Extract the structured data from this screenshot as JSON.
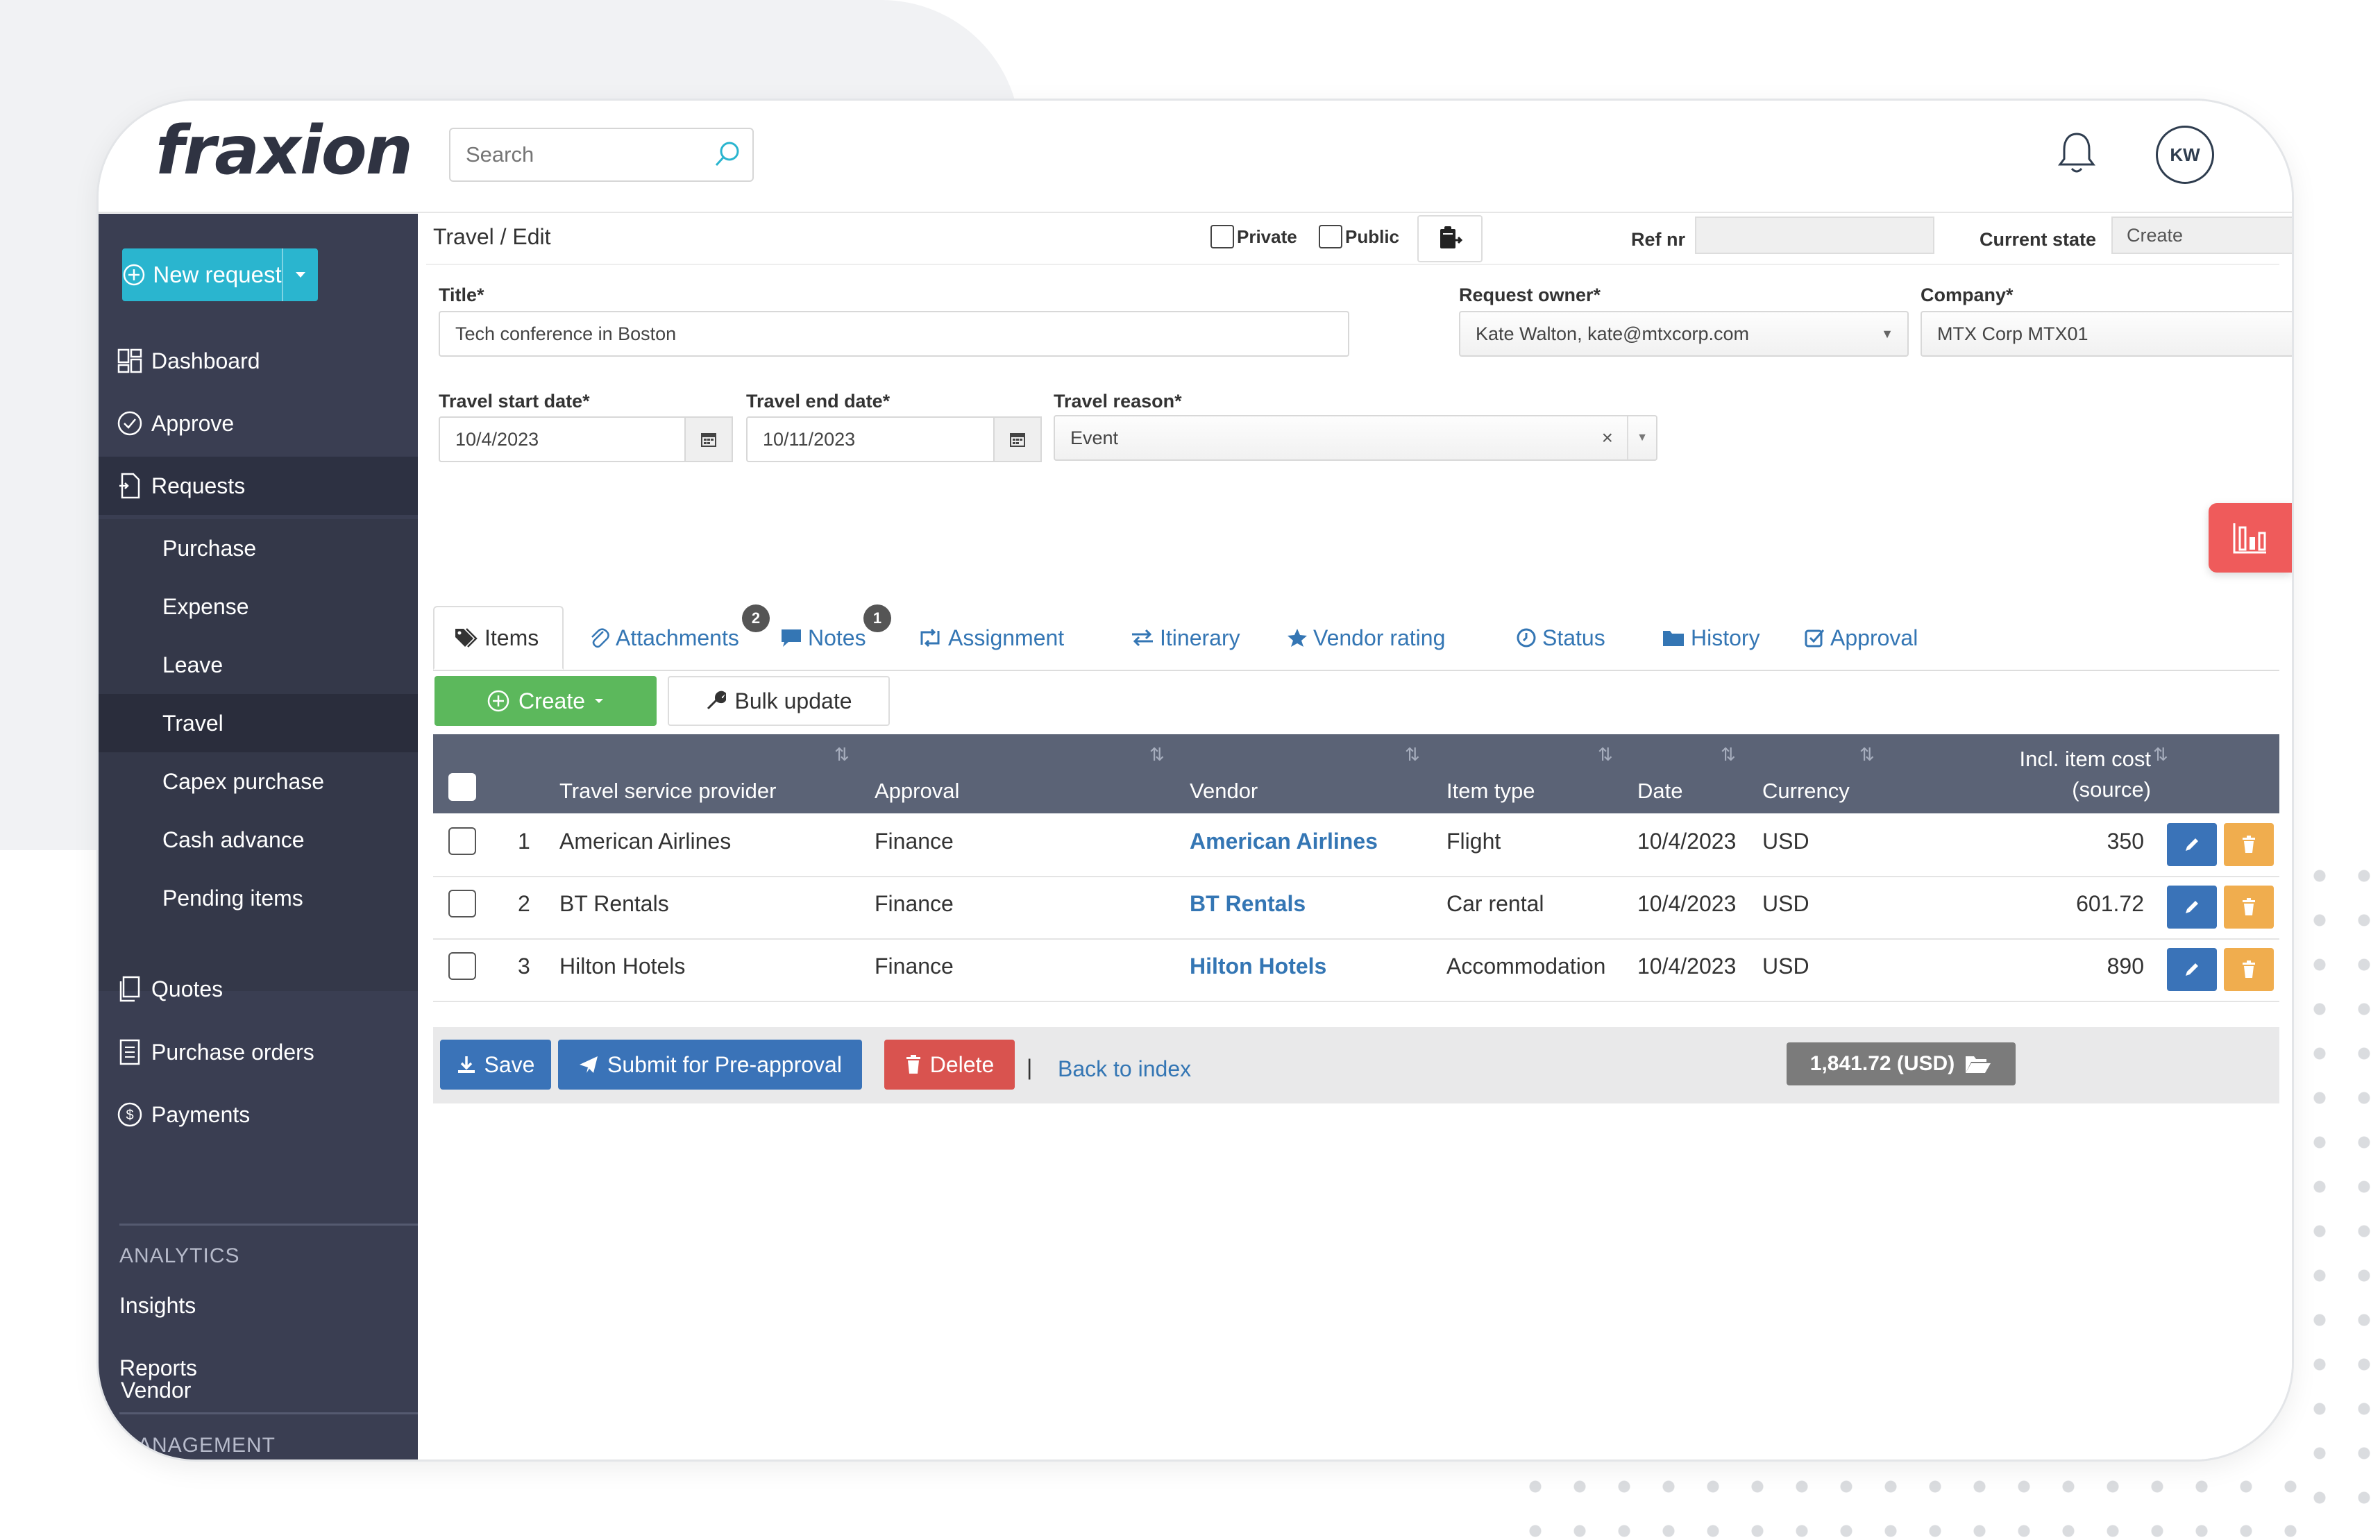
{
  "app": {
    "logo_text": "fraxion",
    "search_placeholder": "Search",
    "avatar_initials": "KW"
  },
  "sidebar": {
    "new_request_label": "New request",
    "top_items": [
      {
        "label": "Dashboard",
        "icon": "dashboard-icon"
      },
      {
        "label": "Approve",
        "icon": "check-circle-icon"
      },
      {
        "label": "Requests",
        "icon": "document-icon"
      }
    ],
    "request_types": [
      "Purchase",
      "Expense",
      "Leave",
      "Travel",
      "Capex purchase",
      "Cash advance",
      "Pending items"
    ],
    "active_request_type": "Travel",
    "more_items": [
      {
        "label": "Quotes",
        "icon": "copy-icon"
      },
      {
        "label": "Purchase orders",
        "icon": "list-doc-icon"
      },
      {
        "label": "Payments",
        "icon": "dollar-circle-icon"
      }
    ],
    "analytics": {
      "title": "ANALYTICS",
      "items": [
        "Insights",
        "Reports"
      ]
    },
    "management": {
      "title": "MANAGEMENT",
      "items": [
        "Vendor"
      ]
    }
  },
  "form": {
    "breadcrumb": "Travel / Edit",
    "private_label": "Private",
    "public_label": "Public",
    "ref_nr_label": "Ref nr",
    "ref_nr_value": "",
    "current_state_label": "Current state",
    "current_state_value": "Create",
    "title_label": "Title*",
    "title_value": "Tech conference in Boston",
    "owner_label": "Request owner*",
    "owner_value": "Kate Walton, kate@mtxcorp.com",
    "company_label": "Company*",
    "company_value": "MTX Corp MTX01",
    "start_label": "Travel start date*",
    "start_value": "10/4/2023",
    "end_label": "Travel end date*",
    "end_value": "10/11/2023",
    "reason_label": "Travel reason*",
    "reason_value": "Event"
  },
  "tabs": [
    {
      "label": "Items",
      "icon": "tags-icon",
      "active": true
    },
    {
      "label": "Attachments",
      "icon": "paperclip-icon",
      "badge": "2"
    },
    {
      "label": "Notes",
      "icon": "comment-icon",
      "badge": "1"
    },
    {
      "label": "Assignment",
      "icon": "retweet-icon"
    },
    {
      "label": "Itinerary",
      "icon": "exchange-icon"
    },
    {
      "label": "Vendor rating",
      "icon": "star-icon"
    },
    {
      "label": "Status",
      "icon": "clock-icon"
    },
    {
      "label": "History",
      "icon": "folder-icon"
    },
    {
      "label": "Approval",
      "icon": "check-square-icon"
    }
  ],
  "toolbar": {
    "create_label": "Create",
    "bulk_update_label": "Bulk update"
  },
  "table": {
    "headers": {
      "provider": "Travel service provider",
      "approval": "Approval",
      "vendor": "Vendor",
      "item_type": "Item type",
      "date": "Date",
      "currency": "Currency",
      "cost_line1": "Incl. item cost",
      "cost_line2": "(source)"
    },
    "rows": [
      {
        "num": "1",
        "provider": "American Airlines",
        "approval": "Finance",
        "vendor": "American Airlines",
        "item_type": "Flight",
        "date": "10/4/2023",
        "currency": "USD",
        "cost": "350"
      },
      {
        "num": "2",
        "provider": "BT Rentals",
        "approval": "Finance",
        "vendor": "BT Rentals",
        "item_type": "Car rental",
        "date": "10/4/2023",
        "currency": "USD",
        "cost": "601.72"
      },
      {
        "num": "3",
        "provider": "Hilton Hotels",
        "approval": "Finance",
        "vendor": "Hilton Hotels",
        "item_type": "Accommodation",
        "date": "10/4/2023",
        "currency": "USD",
        "cost": "890"
      }
    ]
  },
  "footer": {
    "save_label": "Save",
    "submit_label": "Submit for Pre-approval",
    "delete_label": "Delete",
    "separator": "|",
    "back_label": "Back to index",
    "total_label": "1,841.72 (USD)"
  },
  "colors": {
    "sidebar": "#3a3e52",
    "accent": "#2ab5cf",
    "link": "#3476b4",
    "table_header": "#5b6376",
    "float_button": "#ef5b5b"
  }
}
